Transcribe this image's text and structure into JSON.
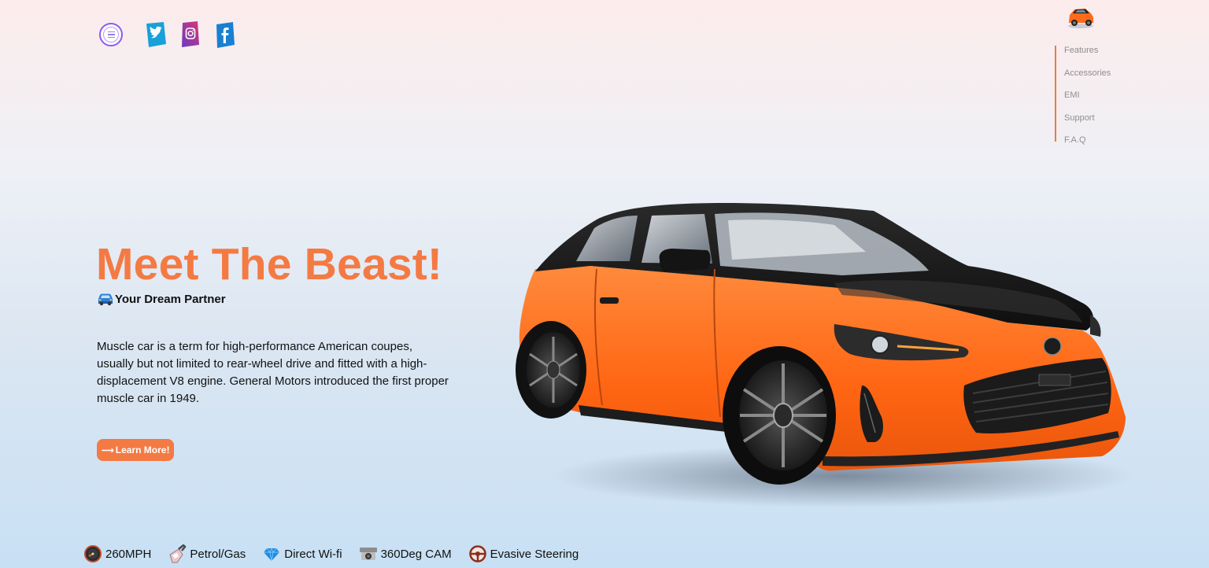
{
  "header": {
    "menu_icon": "menu-icon",
    "social": [
      {
        "name": "twitter-icon",
        "color": "#1da1f2"
      },
      {
        "name": "instagram-icon",
        "color": "#c13584"
      },
      {
        "name": "facebook-icon",
        "color": "#1877f2"
      }
    ]
  },
  "nav": {
    "items": [
      {
        "label": "Features"
      },
      {
        "label": "Accessories"
      },
      {
        "label": "EMI"
      },
      {
        "label": "Support"
      },
      {
        "label": "F.A.Q"
      }
    ]
  },
  "hero": {
    "title": "Meet The Beast!",
    "subtitle": "Your Dream Partner",
    "description": "Muscle car is a term for high-performance American coupes, usually but not limited to rear-wheel drive and fitted with a high-displacement V8 engine. General Motors introduced the first proper muscle car in 1949.",
    "button_label": "Learn More!"
  },
  "features": [
    {
      "label": "260MPH",
      "icon": "speedometer-icon"
    },
    {
      "label": "Petrol/Gas",
      "icon": "fuel-pump-icon"
    },
    {
      "label": "Direct Wi-fi",
      "icon": "wifi-icon"
    },
    {
      "label": "360Deg CAM",
      "icon": "camera-icon"
    },
    {
      "label": "Evasive Steering",
      "icon": "steering-wheel-icon"
    }
  ],
  "colors": {
    "accent": "#f47a43",
    "car_body": "#ff6a1a",
    "car_top": "#1b1b1b",
    "nav_text": "#8f8f8f"
  }
}
